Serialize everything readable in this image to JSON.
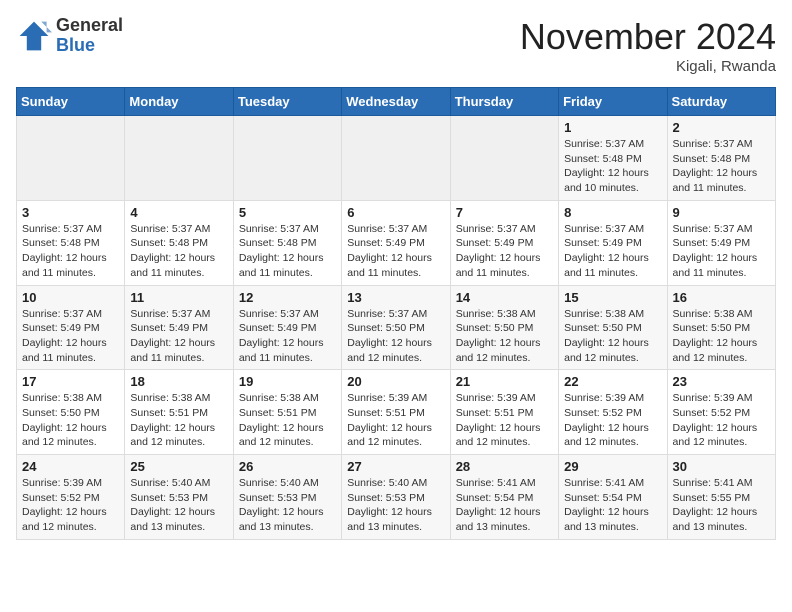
{
  "header": {
    "logo_general": "General",
    "logo_blue": "Blue",
    "month_title": "November 2024",
    "location": "Kigali, Rwanda"
  },
  "weekdays": [
    "Sunday",
    "Monday",
    "Tuesday",
    "Wednesday",
    "Thursday",
    "Friday",
    "Saturday"
  ],
  "weeks": [
    [
      {
        "day": "",
        "info": ""
      },
      {
        "day": "",
        "info": ""
      },
      {
        "day": "",
        "info": ""
      },
      {
        "day": "",
        "info": ""
      },
      {
        "day": "",
        "info": ""
      },
      {
        "day": "1",
        "info": "Sunrise: 5:37 AM\nSunset: 5:48 PM\nDaylight: 12 hours and 10 minutes."
      },
      {
        "day": "2",
        "info": "Sunrise: 5:37 AM\nSunset: 5:48 PM\nDaylight: 12 hours and 11 minutes."
      }
    ],
    [
      {
        "day": "3",
        "info": "Sunrise: 5:37 AM\nSunset: 5:48 PM\nDaylight: 12 hours and 11 minutes."
      },
      {
        "day": "4",
        "info": "Sunrise: 5:37 AM\nSunset: 5:48 PM\nDaylight: 12 hours and 11 minutes."
      },
      {
        "day": "5",
        "info": "Sunrise: 5:37 AM\nSunset: 5:48 PM\nDaylight: 12 hours and 11 minutes."
      },
      {
        "day": "6",
        "info": "Sunrise: 5:37 AM\nSunset: 5:49 PM\nDaylight: 12 hours and 11 minutes."
      },
      {
        "day": "7",
        "info": "Sunrise: 5:37 AM\nSunset: 5:49 PM\nDaylight: 12 hours and 11 minutes."
      },
      {
        "day": "8",
        "info": "Sunrise: 5:37 AM\nSunset: 5:49 PM\nDaylight: 12 hours and 11 minutes."
      },
      {
        "day": "9",
        "info": "Sunrise: 5:37 AM\nSunset: 5:49 PM\nDaylight: 12 hours and 11 minutes."
      }
    ],
    [
      {
        "day": "10",
        "info": "Sunrise: 5:37 AM\nSunset: 5:49 PM\nDaylight: 12 hours and 11 minutes."
      },
      {
        "day": "11",
        "info": "Sunrise: 5:37 AM\nSunset: 5:49 PM\nDaylight: 12 hours and 11 minutes."
      },
      {
        "day": "12",
        "info": "Sunrise: 5:37 AM\nSunset: 5:49 PM\nDaylight: 12 hours and 11 minutes."
      },
      {
        "day": "13",
        "info": "Sunrise: 5:37 AM\nSunset: 5:50 PM\nDaylight: 12 hours and 12 minutes."
      },
      {
        "day": "14",
        "info": "Sunrise: 5:38 AM\nSunset: 5:50 PM\nDaylight: 12 hours and 12 minutes."
      },
      {
        "day": "15",
        "info": "Sunrise: 5:38 AM\nSunset: 5:50 PM\nDaylight: 12 hours and 12 minutes."
      },
      {
        "day": "16",
        "info": "Sunrise: 5:38 AM\nSunset: 5:50 PM\nDaylight: 12 hours and 12 minutes."
      }
    ],
    [
      {
        "day": "17",
        "info": "Sunrise: 5:38 AM\nSunset: 5:50 PM\nDaylight: 12 hours and 12 minutes."
      },
      {
        "day": "18",
        "info": "Sunrise: 5:38 AM\nSunset: 5:51 PM\nDaylight: 12 hours and 12 minutes."
      },
      {
        "day": "19",
        "info": "Sunrise: 5:38 AM\nSunset: 5:51 PM\nDaylight: 12 hours and 12 minutes."
      },
      {
        "day": "20",
        "info": "Sunrise: 5:39 AM\nSunset: 5:51 PM\nDaylight: 12 hours and 12 minutes."
      },
      {
        "day": "21",
        "info": "Sunrise: 5:39 AM\nSunset: 5:51 PM\nDaylight: 12 hours and 12 minutes."
      },
      {
        "day": "22",
        "info": "Sunrise: 5:39 AM\nSunset: 5:52 PM\nDaylight: 12 hours and 12 minutes."
      },
      {
        "day": "23",
        "info": "Sunrise: 5:39 AM\nSunset: 5:52 PM\nDaylight: 12 hours and 12 minutes."
      }
    ],
    [
      {
        "day": "24",
        "info": "Sunrise: 5:39 AM\nSunset: 5:52 PM\nDaylight: 12 hours and 12 minutes."
      },
      {
        "day": "25",
        "info": "Sunrise: 5:40 AM\nSunset: 5:53 PM\nDaylight: 12 hours and 13 minutes."
      },
      {
        "day": "26",
        "info": "Sunrise: 5:40 AM\nSunset: 5:53 PM\nDaylight: 12 hours and 13 minutes."
      },
      {
        "day": "27",
        "info": "Sunrise: 5:40 AM\nSunset: 5:53 PM\nDaylight: 12 hours and 13 minutes."
      },
      {
        "day": "28",
        "info": "Sunrise: 5:41 AM\nSunset: 5:54 PM\nDaylight: 12 hours and 13 minutes."
      },
      {
        "day": "29",
        "info": "Sunrise: 5:41 AM\nSunset: 5:54 PM\nDaylight: 12 hours and 13 minutes."
      },
      {
        "day": "30",
        "info": "Sunrise: 5:41 AM\nSunset: 5:55 PM\nDaylight: 12 hours and 13 minutes."
      }
    ]
  ]
}
